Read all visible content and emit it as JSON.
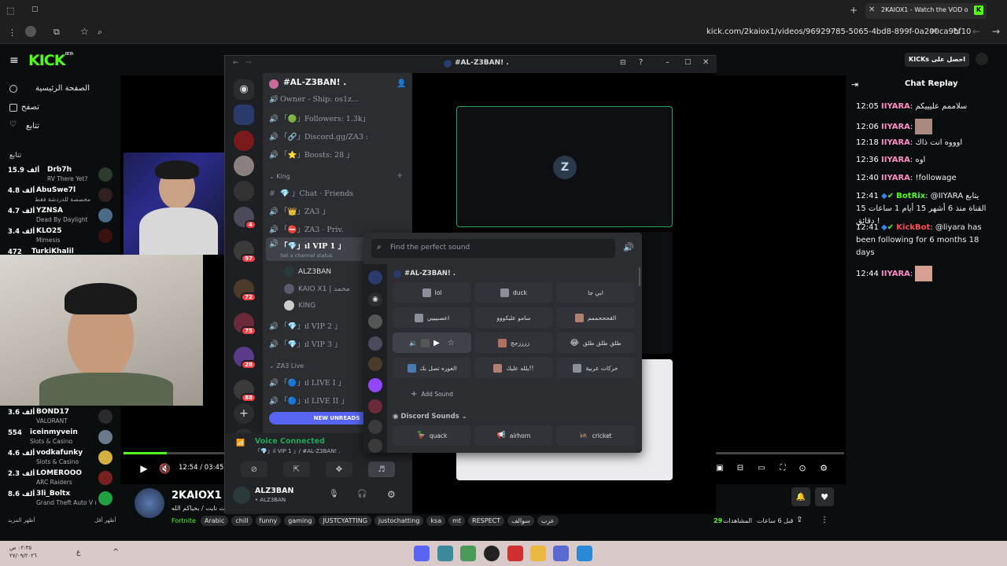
{
  "browser": {
    "tab_title": "2KAIOX1 - Watch the VOD on Kick",
    "url": "kick.com/2kaiox1/videos/96929785-5065-4bd8-899f-0a200ca9bf10"
  },
  "kick": {
    "logo": "KICK",
    "logo_sup": "BETA",
    "promo_button": "احصل على KICKs",
    "nav": [
      {
        "label": "الصفحة الرئيسية",
        "icon": "home-icon"
      },
      {
        "label": "تصفح",
        "icon": "browse-icon"
      },
      {
        "label": "تتابع",
        "icon": "heart-icon"
      }
    ],
    "following_title": "تتابع",
    "channels_top": [
      {
        "name": "Drb7h",
        "count": "15.9 ألف",
        "game": "RV There Yet?"
      },
      {
        "name": "AbuSwe7l",
        "count": "4.8 ألف",
        "game": "مخصصة للدردشة فقط"
      },
      {
        "name": "YZNSA",
        "count": "4.7 ألف",
        "game": "Dead By Daylight"
      },
      {
        "name": "KLO25",
        "count": "3.4 ألف",
        "game": "Mimesis"
      },
      {
        "name": "TurkiKhalil",
        "count": "472",
        "game": ""
      }
    ],
    "channels_bottom": [
      {
        "name": "BOND17",
        "count": "3.6 ألف",
        "game": "VALORANT"
      },
      {
        "name": "iceinmyvein",
        "count": "554",
        "game": "Slots & Casino"
      },
      {
        "name": "vodkafunky",
        "count": "4.6 ألف",
        "game": "Slots & Casino"
      },
      {
        "name": "LOMEROOO",
        "count": "2.3 ألف",
        "game": "ARC Raiders"
      },
      {
        "name": "3li_Boltx",
        "count": "8.6 ألف",
        "game": "Grand Theft Auto V (GTA)..."
      }
    ],
    "show_more": "أظهر المزيد",
    "show_less": "أظهر أقل",
    "player": {
      "time": "12:54 / 03:45:03",
      "progress_fraction": 0.06
    },
    "channel": {
      "name": "2KAIOX1",
      "subtitle": "فورت نايت / بحياكم الله",
      "category": "Fortnite",
      "tags": [
        "Arabic",
        "chill",
        "funny",
        "gaming",
        "JUSTCYATTING",
        "justochatting",
        "ksa",
        "mt",
        "RESPECT",
        "سوالف",
        "عرب"
      ],
      "views": "29",
      "views_label": "المشاهدات",
      "ago": "قبل 6 ساعات"
    },
    "chat": {
      "title": "Chat Replay",
      "messages": [
        {
          "time": "12:05",
          "user": "IIYARA",
          "color": "#ff8cc6",
          "text": "سلاممم عليييكم"
        },
        {
          "time": "12:06",
          "user": "IIYARA",
          "color": "#ff8cc6",
          "text": ""
        },
        {
          "time": "12:18",
          "user": "IIYARA",
          "color": "#ff8cc6",
          "text": "اوووه انت ذاك"
        },
        {
          "time": "12:36",
          "user": "IIYARA",
          "color": "#ff8cc6",
          "text": "اوه"
        },
        {
          "time": "12:40",
          "user": "IIYARA",
          "color": "#ff8cc6",
          "text": "!followage"
        },
        {
          "time": "12:41",
          "user": "BotRix",
          "color": "#53fc18",
          "text": "@IIYARA يتابع القناة منذ 6 أشهر 15 أيام 1 ساعات 15 دقائق !"
        },
        {
          "time": "12:41",
          "user": "KickBot",
          "color": "#ff4d4d",
          "text": "@liyara has been following for 6 months 18 days"
        },
        {
          "time": "12:44",
          "user": "IIYARA",
          "color": "#ff8cc6",
          "text": ""
        }
      ]
    }
  },
  "discord": {
    "window_title": "#AL-Z3BAN! .",
    "server_name": "#AL-Z3BAN! .",
    "channels": [
      {
        "label": "Owner - Ship: os1z...",
        "type": "voice"
      },
      {
        "label": "「🟢」Followers: 1.3k」",
        "type": "voice"
      },
      {
        "label": "「🔗」Discord.gg/ZA3 :",
        "type": "voice"
      },
      {
        "label": "「⭐」Boosts: 28 」",
        "type": "voice"
      }
    ],
    "category_king": "King",
    "king_channels": [
      {
        "label": "💎 」Chat · Friends",
        "type": "text"
      },
      {
        "label": "「👑」ZA3 」",
        "type": "voice"
      },
      {
        "label": "「⛔」ZA3 · Priv.",
        "type": "voice"
      },
      {
        "label": "「💎」ıl VIP 1 」",
        "type": "voice"
      }
    ],
    "set_status": "Set a channel status",
    "vip1_users": [
      "ALZ3BAN",
      "KAIO X1 | محمد",
      "KING"
    ],
    "more_channels": [
      "「💎」ıl VIP 2 」",
      "「💎」ıl VIP 3 」"
    ],
    "category_live": "ZA3 Live",
    "live_channels": [
      "「🔵」ıl LIVE I 」",
      "「🔵」ıl LIVE II 」"
    ],
    "new_unreads": "NEW UNREADS",
    "voice_connected": "Voice Connected",
    "voice_channel": "「💎」ıl VIP 1 」/ #AL-Z3BAN! .",
    "user_name": "ALZ3BAN",
    "user_status": "• ALZ3BAN",
    "guild_badges": [
      "4",
      "97",
      "72",
      "75",
      "28",
      "88"
    ],
    "soundboard": {
      "search_placeholder": "Find the perfect sound",
      "server_section": "#AL-Z3BAN! .",
      "sounds": [
        "lol",
        "duck",
        "ابي جا",
        "اعصبيييي",
        "سامو عليكووو",
        "القحححممم",
        "",
        "ززززجج",
        "طلق طلق طلق",
        "العوره تصل بك",
        "يلله عليك!!",
        "حركات عربية"
      ],
      "add_sound": "Add Sound",
      "discord_section": "Discord Sounds",
      "discord_sounds": [
        "quack",
        "airhorn",
        "cricket"
      ]
    }
  },
  "taskbar": {
    "time": "٠٢:٣٥ ص",
    "date": "٢٧/٠٩/٢٠٢٦"
  }
}
